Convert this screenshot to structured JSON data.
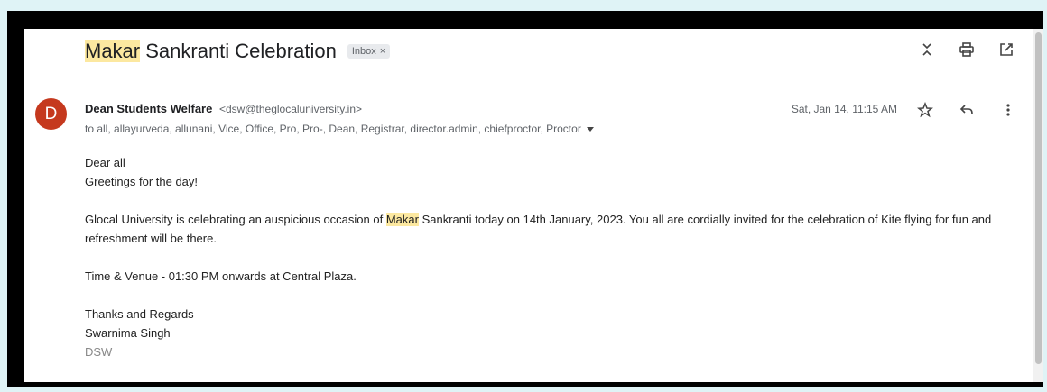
{
  "email": {
    "subject_highlight": "Makar",
    "subject_rest": " Sankranti Celebration",
    "label": "Inbox",
    "label_close": "×",
    "sender_initial": "D",
    "sender_name": "Dean Students Welfare",
    "sender_email": "<dsw@theglocaluniversity.in>",
    "recipients": "to all, allayurveda, allunani, Vice, Office, Pro, Pro-, Dean, Registrar, director.admin, chiefproctor, Proctor",
    "date": "Sat, Jan 14, 11:15 AM"
  },
  "body": {
    "greeting": "Dear all",
    "line2": "Greetings for the day!",
    "para_before": "Glocal University is celebrating an auspicious occasion of ",
    "para_highlight": "Makar",
    "para_after": " Sankranti today on 14th January, 2023. You all are cordially invited for the celebration of Kite flying for fun and refreshment will be there.",
    "venue": "Time & Venue - 01:30 PM onwards at Central Plaza.",
    "signoff": "Thanks and Regards",
    "signer": "Swarnima Singh",
    "title": "DSW"
  },
  "icons": [
    "collapse-icon",
    "print-icon",
    "open-new-window-icon",
    "star-icon",
    "reply-icon",
    "more-vert-icon"
  ],
  "colors": {
    "avatar": "#c5391e",
    "highlight": "#fce8a0",
    "background": "#dff3f6"
  }
}
